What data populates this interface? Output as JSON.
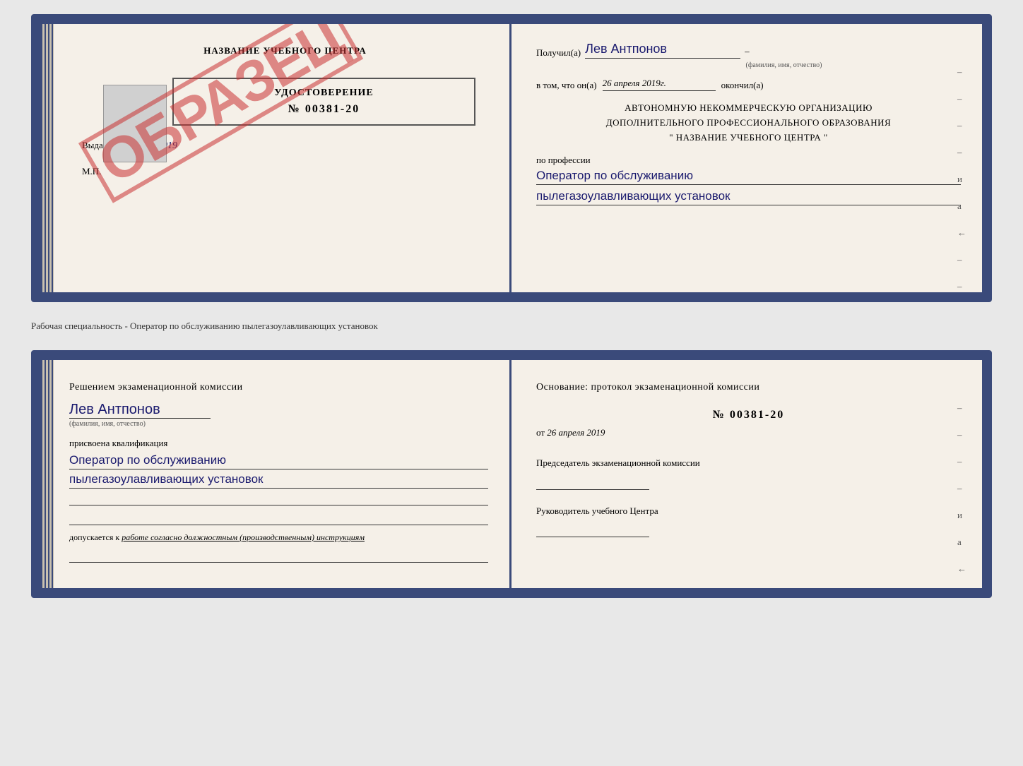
{
  "top_spread": {
    "left": {
      "title": "НАЗВАНИЕ УЧЕБНОГО ЦЕНТРА",
      "watermark": "ОБРАЗЕЦ",
      "certificate": {
        "label": "УДОСТОВЕРЕНИЕ",
        "number": "№ 00381-20"
      },
      "issued_label": "Выдано",
      "issued_date": "26 апреля 2019",
      "mp_label": "М.П."
    },
    "right": {
      "received_label": "Получил(а)",
      "recipient_name": "Лев Антпонов",
      "fio_caption": "(фамилия, имя, отчество)",
      "vtom_label": "в том, что он(а)",
      "vtom_date": "26 апреля 2019г.",
      "okoncil_label": "окончил(а)",
      "org_line1": "АВТОНОМНУЮ НЕКОММЕРЧЕСКУЮ ОРГАНИЗАЦИЮ",
      "org_line2": "ДОПОЛНИТЕЛЬНОГО ПРОФЕССИОНАЛЬНОГО ОБРАЗОВАНИЯ",
      "org_line3": "\"  НАЗВАНИЕ УЧЕБНОГО ЦЕНТРА  \"",
      "profession_label": "по профессии",
      "profession_line1": "Оператор по обслуживанию",
      "profession_line2": "пылегазоулавливающих установок"
    }
  },
  "separator": {
    "text": "Рабочая специальность - Оператор по обслуживанию пылегазоулавливающих установок"
  },
  "bottom_spread": {
    "left": {
      "commission_text": "Решением экзаменационной комиссии",
      "person_name": "Лев Антпонов",
      "fio_caption": "(фамилия, имя, отчество)",
      "kvali_label": "присвоена квалификация",
      "kvali_line1": "Оператор по обслуживанию",
      "kvali_line2": "пылегазоулавливающих установок",
      "dopusk_label": "допускается к",
      "dopusk_text": "работе согласно должностным (производственным) инструкциям"
    },
    "right": {
      "osnov_label": "Основание: протокол экзаменационной комиссии",
      "protocol_number": "№  00381-20",
      "protocol_date_prefix": "от",
      "protocol_date": "26 апреля 2019",
      "chairman_label": "Председатель экзаменационной комиссии",
      "rukov_label": "Руководитель учебного Центра"
    }
  }
}
